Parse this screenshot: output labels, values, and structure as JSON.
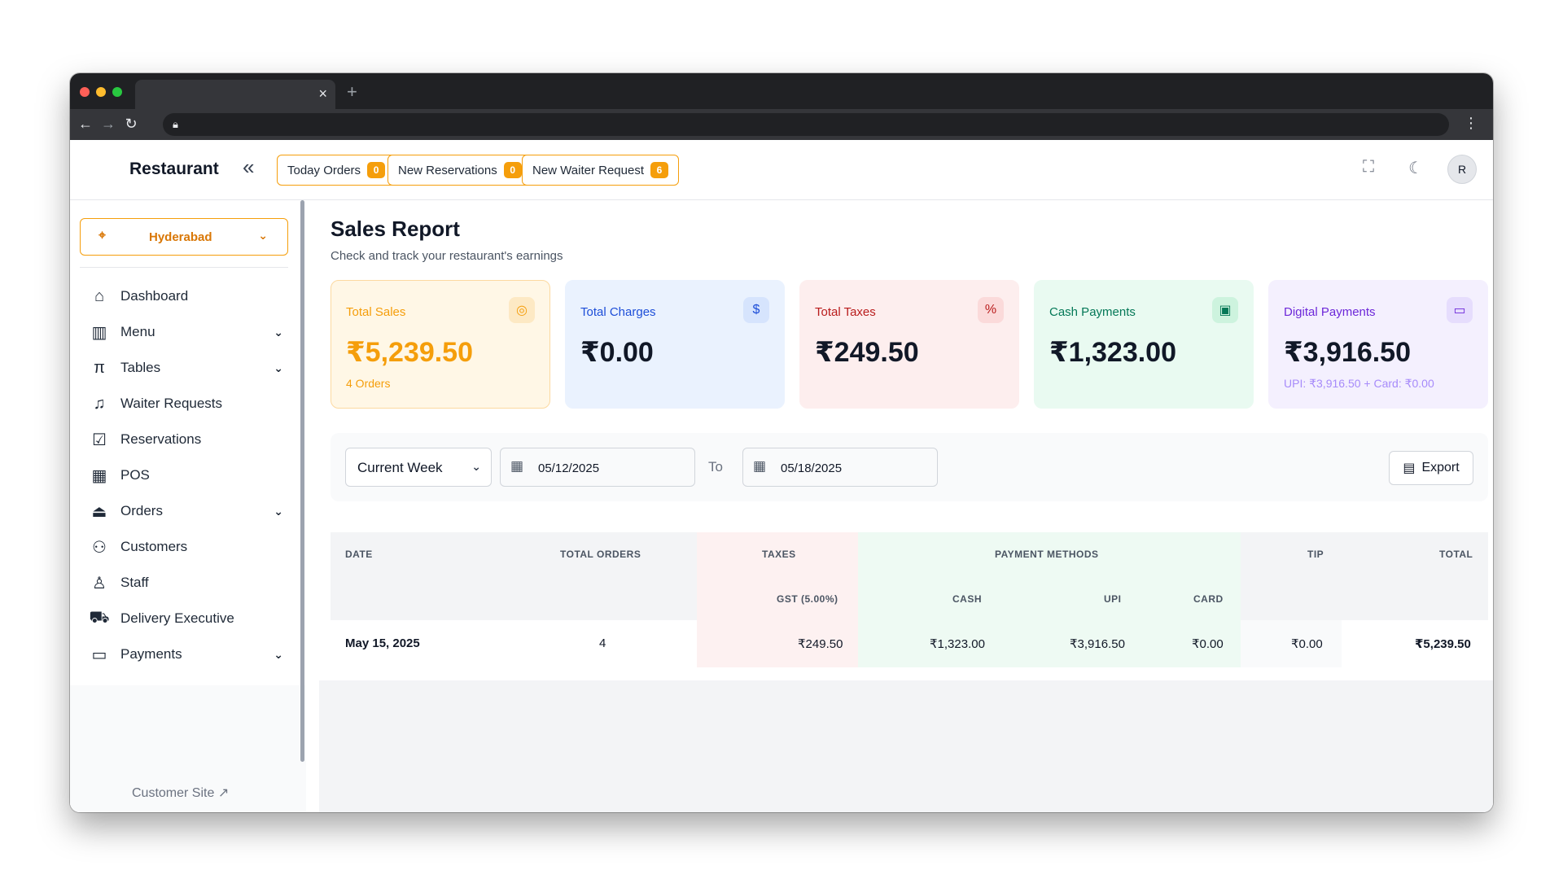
{
  "browser": {
    "tab_close": "×",
    "new_tab": "+"
  },
  "header": {
    "brand": "Restaurant",
    "pills": [
      {
        "label": "Today Orders",
        "count": "0"
      },
      {
        "label": "New Reservations",
        "count": "0"
      },
      {
        "label": "New Waiter Request",
        "count": "6"
      }
    ],
    "avatar": "R"
  },
  "sidebar": {
    "location": "Hyderabad",
    "items": [
      {
        "label": "Dashboard",
        "icon": "home-icon"
      },
      {
        "label": "Menu",
        "icon": "menu-book-icon",
        "expandable": true
      },
      {
        "label": "Tables",
        "icon": "table-icon",
        "expandable": true
      },
      {
        "label": "Waiter Requests",
        "icon": "bell-icon"
      },
      {
        "label": "Reservations",
        "icon": "calendar-check-icon"
      },
      {
        "label": "POS",
        "icon": "pos-icon"
      },
      {
        "label": "Orders",
        "icon": "cloche-icon",
        "expandable": true
      },
      {
        "label": "Customers",
        "icon": "users-icon"
      },
      {
        "label": "Staff",
        "icon": "staff-icon"
      },
      {
        "label": "Delivery Executive",
        "icon": "scooter-icon"
      },
      {
        "label": "Payments",
        "icon": "wallet-icon",
        "expandable": true
      }
    ],
    "customer_site": "Customer Site"
  },
  "page": {
    "title": "Sales Report",
    "subtitle": "Check and track your restaurant's earnings"
  },
  "cards": [
    {
      "title": "Total Sales",
      "value": "₹5,239.50",
      "sub": "4 Orders",
      "icon": "target-icon",
      "bg": "#fff7e6",
      "border": "#fcd9a0",
      "fg": "#f59e0b",
      "value_color": "#f59e0b",
      "icon_bg": "#fde9c4"
    },
    {
      "title": "Total Charges",
      "value": "₹0.00",
      "sub": "",
      "icon": "dollar-circle-icon",
      "bg": "#eaf2fe",
      "border": "#eaf2fe",
      "fg": "#1d4ed8",
      "value_color": "#111827",
      "icon_bg": "#d6e4fd"
    },
    {
      "title": "Total Taxes",
      "value": "₹249.50",
      "sub": "",
      "icon": "percent-icon",
      "bg": "#fdeeee",
      "border": "#fdeeee",
      "fg": "#b91c1c",
      "value_color": "#111827",
      "icon_bg": "#fbdada"
    },
    {
      "title": "Cash Payments",
      "value": "₹1,323.00",
      "sub": "",
      "icon": "cash-icon",
      "bg": "#e9faf1",
      "border": "#e9faf1",
      "fg": "#047857",
      "value_color": "#111827",
      "icon_bg": "#cdf3de"
    },
    {
      "title": "Digital Payments",
      "value": "₹3,916.50",
      "sub": "UPI: ₹3,916.50 + Card: ₹0.00",
      "icon": "card-icon",
      "bg": "#f4f0fe",
      "border": "#f4f0fe",
      "fg": "#6d28d9",
      "value_color": "#111827",
      "icon_bg": "#e6ddfd"
    }
  ],
  "filters": {
    "period": "Current Week",
    "start_date": "05/12/2025",
    "to_label": "To",
    "end_date": "05/18/2025",
    "export_label": "Export"
  },
  "table": {
    "headers": {
      "date": "DATE",
      "total_orders": "TOTAL ORDERS",
      "taxes": "TAXES",
      "payment_methods": "PAYMENT METHODS",
      "tip": "TIP",
      "total": "TOTAL",
      "gst": "GST (5.00%)",
      "cash": "CASH",
      "upi": "UPI",
      "card": "CARD"
    },
    "rows": [
      {
        "date": "May 15, 2025",
        "total_orders": "4",
        "gst": "₹249.50",
        "cash": "₹1,323.00",
        "upi": "₹3,916.50",
        "card": "₹0.00",
        "tip": "₹0.00",
        "total": "₹5,239.50"
      }
    ]
  }
}
